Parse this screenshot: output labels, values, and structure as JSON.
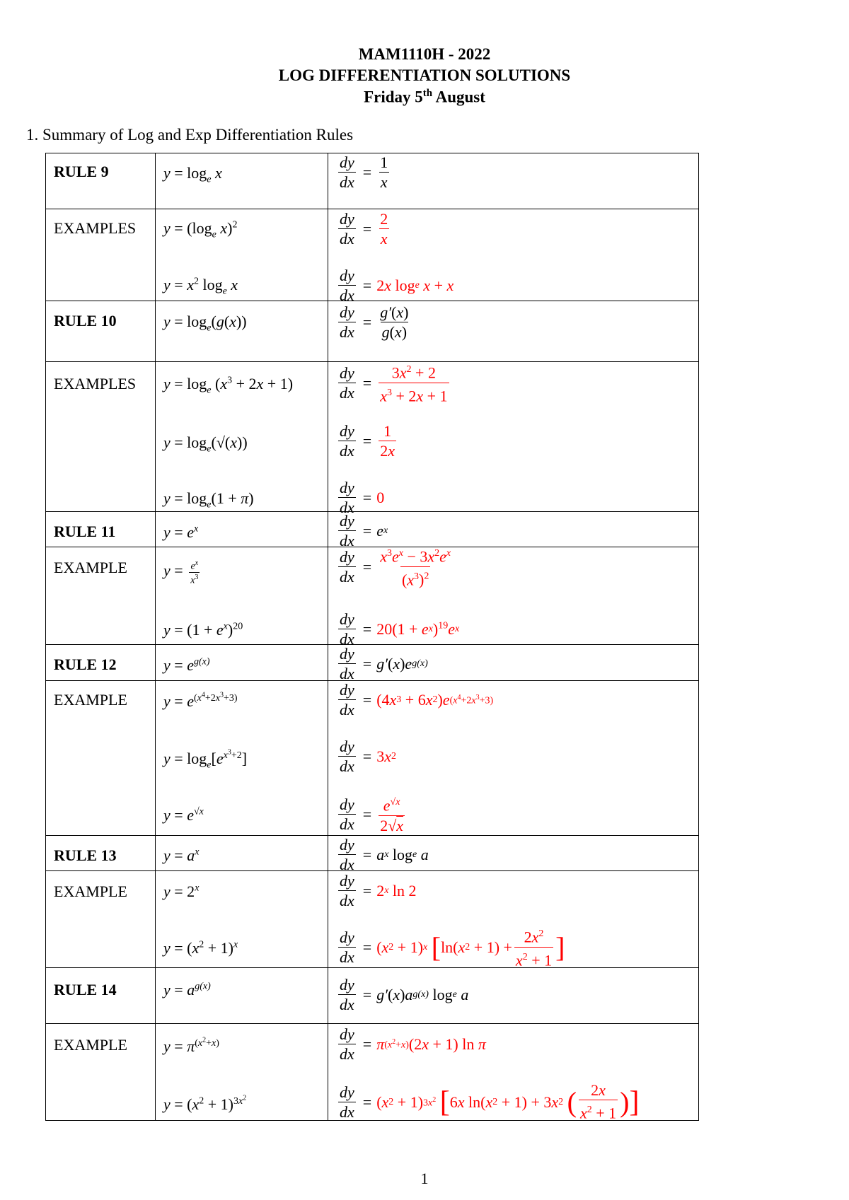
{
  "header": {
    "course": "MAM1110H - 2022",
    "title": "LOG DIFFERENTIATION SOLUTIONS",
    "date_prefix": "Friday 5",
    "date_sup": "th",
    "date_suffix": " August"
  },
  "section": {
    "number": "1.",
    "title": "Summary of Log and Exp Differentiation Rules"
  },
  "colors": {
    "answer": "#ff0000",
    "text": "#000000"
  },
  "derivative_label": {
    "num": "dy",
    "den": "dx",
    "equals": "="
  },
  "rows": [
    {
      "label": "RULE 9",
      "function": "y = logₑ x",
      "derivative": "1/x",
      "answer": false
    },
    {
      "label": "EXAMPLES",
      "function": "y = (logₑ x)²",
      "derivative": "2/x",
      "answer": true
    },
    {
      "label": "",
      "function": "y = x² logₑ x",
      "derivative": "2x logₑ x + x",
      "answer": true
    },
    {
      "label": "RULE 10",
      "function": "y = logₑ(g(x))",
      "derivative": "g′(x)/g(x)",
      "answer": false
    },
    {
      "label": "EXAMPLES",
      "function": "y = logₑ (x³ + 2x + 1)",
      "derivative": "(3x² + 2)/(x³ + 2x + 1)",
      "answer": true
    },
    {
      "label": "",
      "function": "y = logₑ(√(x))",
      "derivative": "1/(2x)",
      "answer": true
    },
    {
      "label": "",
      "function": "y = logₑ(1 + π)",
      "derivative": "0",
      "answer": true
    },
    {
      "label": "RULE 11",
      "function": "y = eˣ",
      "derivative": "eˣ",
      "answer": false
    },
    {
      "label": "EXAMPLE",
      "function": "y = eˣ/x³",
      "derivative": "(x³eˣ − 3x²eˣ)/(x³)²",
      "answer": true
    },
    {
      "label": "",
      "function": "y = (1 + eˣ)²⁰",
      "derivative": "20(1 + eˣ)¹⁹eˣ",
      "answer": true
    },
    {
      "label": "RULE 12",
      "function": "y = e^g(x)",
      "derivative": "g′(x)e^g(x)",
      "answer": false
    },
    {
      "label": "EXAMPLE",
      "function": "y = e^(x⁴+2x³+3)",
      "derivative": "(4x³ + 6x²)e^(x⁴+2x³+3)",
      "answer": true
    },
    {
      "label": "",
      "function": "y = logₑ[e^(x³+2)]",
      "derivative": "3x²",
      "answer": true
    },
    {
      "label": "",
      "function": "y = e^√x",
      "derivative": "e^√x/(2√x)",
      "answer": true
    },
    {
      "label": "RULE 13",
      "function": "y = aˣ",
      "derivative": "aˣ logₑ a",
      "answer": false
    },
    {
      "label": "EXAMPLE",
      "function": "y = 2ˣ",
      "derivative": "2ˣ ln 2",
      "answer": true
    },
    {
      "label": "",
      "function": "y = (x² + 1)ˣ",
      "derivative": "(x² + 1)ˣ [ln(x² + 1) + 2x²/(x² + 1)]",
      "answer": true
    },
    {
      "label": "RULE 14",
      "function": "y = a^g(x)",
      "derivative": "g′(x)a^g(x) logₑ a",
      "answer": false
    },
    {
      "label": "EXAMPLE",
      "function": "y = π^(x²+x)",
      "derivative": "π^(x²+x)(2x + 1) ln π",
      "answer": true
    },
    {
      "label": "",
      "function": "y = (x² + 1)^(3x²)",
      "derivative": "(x² + 1)^(3x²) [6x ln(x² + 1) + 3x² (2x/(x² + 1))]",
      "answer": true
    }
  ],
  "page_number": "1"
}
